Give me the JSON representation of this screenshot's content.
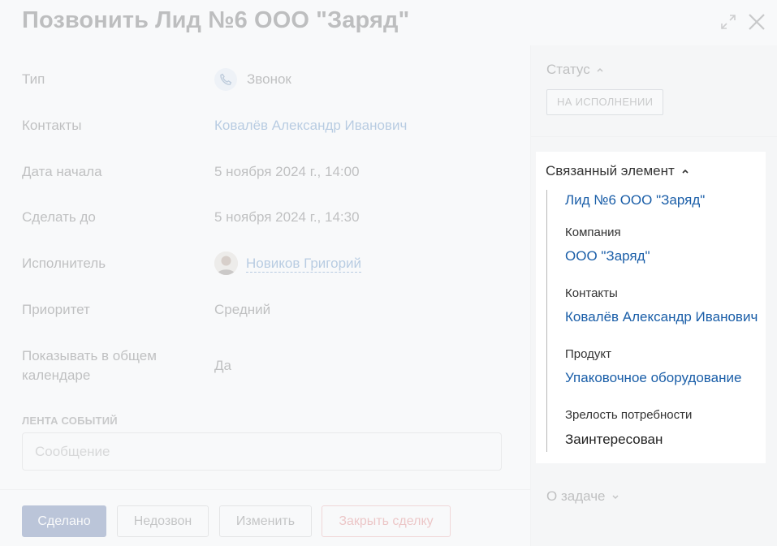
{
  "header": {
    "title": "Позвонить Лид №6 ООО \"Заряд\"",
    "expand_icon": "expand-icon",
    "close_icon": "close-icon"
  },
  "fields": {
    "type": {
      "label": "Тип",
      "value": "Звонок",
      "icon": "phone-icon"
    },
    "contacts": {
      "label": "Контакты",
      "value": "Ковалёв Александр Иванович"
    },
    "start_date": {
      "label": "Дата начала",
      "value": "5 ноября 2024 г., 14:00"
    },
    "due_date": {
      "label": "Сделать до",
      "value": "5 ноября 2024 г., 14:30"
    },
    "assignee": {
      "label": "Исполнитель",
      "value": "Новиков Григорий",
      "icon": "avatar"
    },
    "priority": {
      "label": "Приоритет",
      "value": "Средний"
    },
    "calendar": {
      "label_line1": "Показывать в общем",
      "label_line2": "календаре",
      "value": "Да"
    }
  },
  "feed": {
    "label": "ЛЕНТА СОБЫТИЙ",
    "placeholder": "Сообщение"
  },
  "buttons": {
    "done": "Сделано",
    "no_answer": "Недозвон",
    "edit": "Изменить",
    "close_deal": "Закрыть сделку"
  },
  "sidebar": {
    "status": {
      "title": "Статус",
      "value": "НА ИСПОЛНЕНИИ"
    },
    "linked": {
      "title": "Связанный элемент",
      "lead": "Лид №6 ООО \"Заряд\"",
      "company_label": "Компания",
      "company_value": "ООО \"Заряд\"",
      "contacts_label": "Контакты",
      "contacts_value": "Ковалёв Александр Иванович",
      "product_label": "Продукт",
      "product_value": "Упаковочное оборудование",
      "maturity_label": "Зрелость потребности",
      "maturity_value": "Заинтересован"
    },
    "about": {
      "title": "О задаче"
    }
  },
  "colors": {
    "accent": "#1a5ea8",
    "primary_button": "#25458a",
    "danger": "#d34a4a"
  }
}
